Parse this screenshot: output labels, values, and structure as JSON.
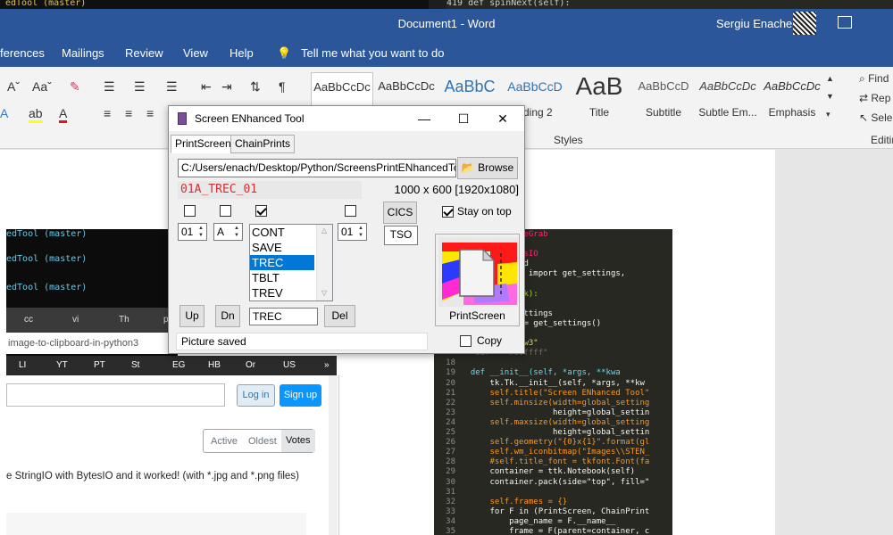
{
  "bg_editor": {
    "left_text": "edTool (master)",
    "right_text": "419        def spinNext(self):"
  },
  "word": {
    "document_title": "Document1 - Word",
    "user_name": "Sergiu Enache",
    "tabs": [
      "ferences",
      "Mailings",
      "Review",
      "View",
      "Help"
    ],
    "tell_me": "Tell me what you want to do",
    "styles": [
      {
        "sample": "AaBbCcDc",
        "name": ""
      },
      {
        "sample": "AaBbCcDc",
        "name": ""
      },
      {
        "sample": "AaBbC",
        "name": ""
      },
      {
        "sample": "AaBbCcD",
        "name": "ading 2"
      },
      {
        "sample": "AaB",
        "name": "Title"
      },
      {
        "sample": "AaBbCcD",
        "name": "Subtitle"
      },
      {
        "sample": "AaBbCcDc",
        "name": "Subtle Em..."
      },
      {
        "sample": "AaBbCcDc",
        "name": "Emphasis"
      }
    ],
    "styles_group": "Styles",
    "editing_group": "Editing",
    "find": "Find",
    "replace": "Rep",
    "select": "Sele"
  },
  "terminal": {
    "lines": [
      "edTool (master)",
      "edTool (master)",
      "edTool (master)"
    ]
  },
  "browser": {
    "url": "image-to-clipboard-in-python3",
    "tabs": [
      "cc",
      "vi",
      "Th",
      "pj"
    ],
    "bookmarks": [
      "LI",
      "YT",
      "PT",
      "St",
      "EG",
      "HB",
      "Or",
      "US"
    ]
  },
  "stackoverflow": {
    "login": "Log in",
    "signup": "Sign up",
    "sort": [
      "Active",
      "Oldest",
      "Votes"
    ],
    "answer_text": "e StringIO with BytesIO and it worked! (with *.jpg and *.png files)"
  },
  "code": {
    "lines": [
      {
        "n": "",
        "t": "   mport ImageGrab"
      },
      {
        "n": "",
        "t": "   mport path"
      },
      {
        "n": "",
        "t": "   mport BytesIO"
      },
      {
        "n": "",
        "t": "   32clipboard"
      },
      {
        "n": "",
        "t": "   t_settings import get_settings,"
      },
      {
        "n": "",
        "t": ""
      },
      {
        "n": "",
        "t": "   leApp(tk.Tk):"
      },
      {
        "n": "",
        "t": ""
      },
      {
        "n": "",
        "t": "    global_settings"
      },
      {
        "n": "",
        "t": "   _settings = get_settings()"
      },
      {
        "n": "",
        "t": "    mycolour"
      },
      {
        "n": "",
        "t": "   our = \"snow3\""
      },
      {
        "n": "",
        "t": "   our = \"#00ffff\""
      },
      {
        "n": "18",
        "t": ""
      },
      {
        "n": "19",
        "t": "  def __init__(self, *args, **kwa"
      },
      {
        "n": "20",
        "t": "      tk.Tk.__init__(self, *args, **kw"
      },
      {
        "n": "21",
        "t": "      self.title(\"Screen ENhanced Tool\""
      },
      {
        "n": "22",
        "t": "      self.minsize(width=global_setting"
      },
      {
        "n": "23",
        "t": "                   height=global_settin"
      },
      {
        "n": "24",
        "t": "      self.maxsize(width=global_setting"
      },
      {
        "n": "25",
        "t": "                   height=global_settin"
      },
      {
        "n": "26",
        "t": "      self.geometry(\"{0}x{1}\".format(gl"
      },
      {
        "n": "27",
        "t": "      self.wm_iconbitmap(\"Images\\\\STEN_"
      },
      {
        "n": "28",
        "t": "      #self.title_font = tkfont.Font(fa"
      },
      {
        "n": "29",
        "t": "      container = ttk.Notebook(self)"
      },
      {
        "n": "30",
        "t": "      container.pack(side=\"top\", fill=\""
      },
      {
        "n": "31",
        "t": ""
      },
      {
        "n": "32",
        "t": "      self.frames = {}"
      },
      {
        "n": "33",
        "t": "      for F in (PrintScreen, ChainPrint"
      },
      {
        "n": "34",
        "t": "          page_name = F.__name__"
      },
      {
        "n": "35",
        "t": "          frame = F(parent=container, c"
      }
    ]
  },
  "tool": {
    "title": "Screen ENhanced Tool",
    "tabs": [
      "PrintScreen",
      "ChainPrints"
    ],
    "path": "C:/Users/enach/Desktop/Python/ScreensPrintENhancedTo",
    "browse": "Browse",
    "filename": "01A_TREC_01",
    "resolution": "1000 x 600 [1920x1080]",
    "spin1": "01",
    "spin2": "A",
    "spin3": "01",
    "list_items": [
      "CONT",
      "SAVE",
      "TREC",
      "TBLT",
      "TREV"
    ],
    "selected_item": "TREC",
    "cics": "CICS",
    "tso": "TSO",
    "stay_on_top": "Stay on top",
    "printscreen": "PrintScreen",
    "up": "Up",
    "dn": "Dn",
    "entry_value": "TREC",
    "del": "Del",
    "status": "Picture saved",
    "copy": "Copy"
  }
}
